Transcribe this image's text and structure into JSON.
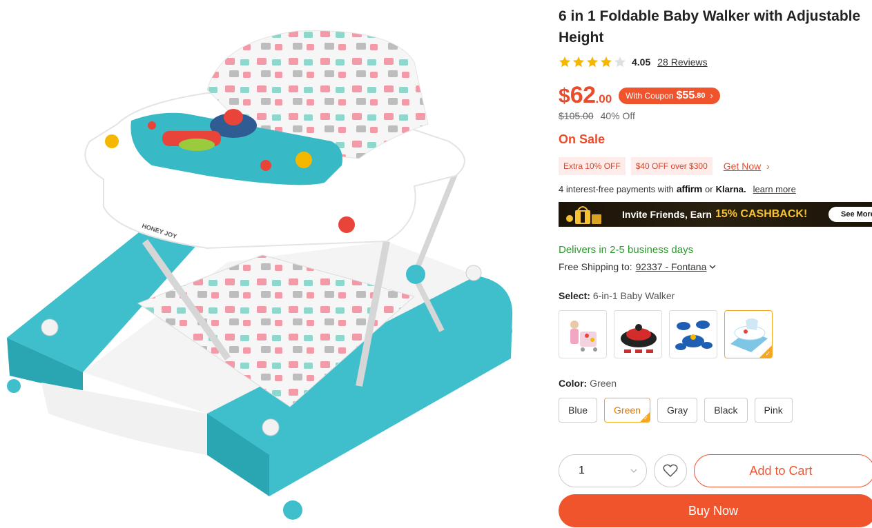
{
  "product": {
    "title": "6 in 1 Foldable Baby Walker with Adjustable Height",
    "image_brand_text": "HONEY JOY"
  },
  "rating": {
    "stars_filled": 4.05,
    "stars_total": 5,
    "value": "4.05",
    "reviews": "28 Reviews"
  },
  "price": {
    "currency": "$",
    "integer": "62",
    "decimal": ".00",
    "coupon_label": "With Coupon",
    "coupon_currency_int": "$55",
    "coupon_decimal": ".80",
    "original": "$105.00",
    "discount": "40% Off",
    "status": "On Sale"
  },
  "promos": {
    "tag1": "Extra 10% OFF",
    "tag2": "$40 OFF over $300",
    "get_now": "Get Now"
  },
  "payment": {
    "prefix": "4 interest-free payments with",
    "affirm": "affirm",
    "or": "or",
    "klarna": "Klarna.",
    "learn_more": "learn more"
  },
  "banner": {
    "text": "Invite Friends, Earn",
    "highlight": "15% CASHBACK!",
    "button": "See More"
  },
  "shipping": {
    "delivers": "Delivers in 2-5 business days",
    "label": "Free Shipping to:",
    "zip": "92337 - Fontana"
  },
  "variants": {
    "label": "Select:",
    "selected": "6-in-1 Baby Walker",
    "selected_index": 3
  },
  "colors": {
    "label": "Color:",
    "selected": "Green",
    "options": [
      "Blue",
      "Green",
      "Gray",
      "Black",
      "Pink"
    ]
  },
  "cart": {
    "quantity": "1",
    "add_to_cart": "Add to Cart",
    "buy_now": "Buy Now"
  },
  "theme": {
    "accent": "#f0542d",
    "price_red": "#e84c2c",
    "selected_orange": "#f5a623",
    "delivery_green": "#2e9a2e",
    "star_gold": "#f5b800"
  }
}
